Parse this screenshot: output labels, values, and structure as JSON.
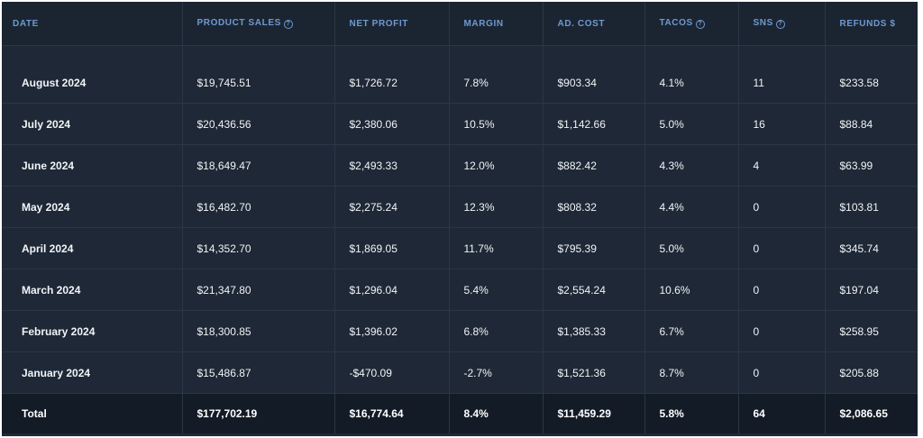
{
  "columns": [
    {
      "label": "DATE",
      "info": false
    },
    {
      "label": "PRODUCT SALES",
      "info": true
    },
    {
      "label": "NET PROFIT",
      "info": false
    },
    {
      "label": "MARGIN",
      "info": false
    },
    {
      "label": "AD. COST",
      "info": false
    },
    {
      "label": "TACOS",
      "info": true
    },
    {
      "label": "SNS",
      "info": true
    },
    {
      "label": "REFUNDS $",
      "info": false
    }
  ],
  "info_glyph": "?",
  "rows": [
    [
      "August 2024",
      "$19,745.51",
      "$1,726.72",
      "7.8%",
      "$903.34",
      "4.1%",
      "11",
      "$233.58"
    ],
    [
      "July 2024",
      "$20,436.56",
      "$2,380.06",
      "10.5%",
      "$1,142.66",
      "5.0%",
      "16",
      "$88.84"
    ],
    [
      "June 2024",
      "$18,649.47",
      "$2,493.33",
      "12.0%",
      "$882.42",
      "4.3%",
      "4",
      "$63.99"
    ],
    [
      "May 2024",
      "$16,482.70",
      "$2,275.24",
      "12.3%",
      "$808.32",
      "4.4%",
      "0",
      "$103.81"
    ],
    [
      "April 2024",
      "$14,352.70",
      "$1,869.05",
      "11.7%",
      "$795.39",
      "5.0%",
      "0",
      "$345.74"
    ],
    [
      "March 2024",
      "$21,347.80",
      "$1,296.04",
      "5.4%",
      "$2,554.24",
      "10.6%",
      "0",
      "$197.04"
    ],
    [
      "February 2024",
      "$18,300.85",
      "$1,396.02",
      "6.8%",
      "$1,385.33",
      "6.7%",
      "0",
      "$258.95"
    ],
    [
      "January 2024",
      "$15,486.87",
      "-$470.09",
      "-2.7%",
      "$1,521.36",
      "8.7%",
      "0",
      "$205.88"
    ]
  ],
  "total": [
    "Total",
    "$177,702.19",
    "$16,774.64",
    "8.4%",
    "$11,459.29",
    "5.8%",
    "64",
    "$2,086.65"
  ],
  "colors": {
    "background": "#1e2836",
    "header_background": "#1b2532",
    "header_text": "#6f9ad0",
    "cell_text": "#f2f4f7",
    "grid_line": "#2b3646",
    "total_background": "#131b26"
  }
}
